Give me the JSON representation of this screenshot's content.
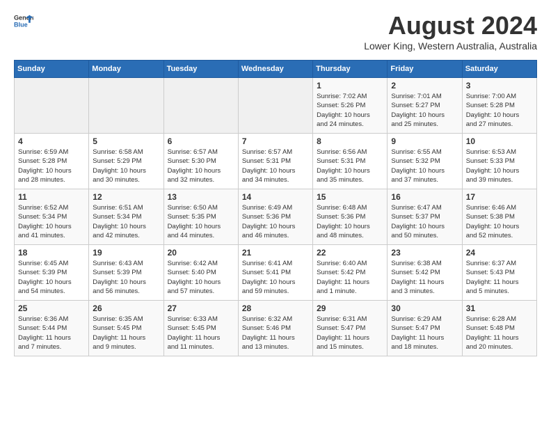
{
  "header": {
    "logo_general": "General",
    "logo_blue": "Blue",
    "title": "August 2024",
    "subtitle": "Lower King, Western Australia, Australia"
  },
  "weekdays": [
    "Sunday",
    "Monday",
    "Tuesday",
    "Wednesday",
    "Thursday",
    "Friday",
    "Saturday"
  ],
  "weeks": [
    [
      {
        "day": "",
        "info": ""
      },
      {
        "day": "",
        "info": ""
      },
      {
        "day": "",
        "info": ""
      },
      {
        "day": "",
        "info": ""
      },
      {
        "day": "1",
        "info": "Sunrise: 7:02 AM\nSunset: 5:26 PM\nDaylight: 10 hours\nand 24 minutes."
      },
      {
        "day": "2",
        "info": "Sunrise: 7:01 AM\nSunset: 5:27 PM\nDaylight: 10 hours\nand 25 minutes."
      },
      {
        "day": "3",
        "info": "Sunrise: 7:00 AM\nSunset: 5:28 PM\nDaylight: 10 hours\nand 27 minutes."
      }
    ],
    [
      {
        "day": "4",
        "info": "Sunrise: 6:59 AM\nSunset: 5:28 PM\nDaylight: 10 hours\nand 28 minutes."
      },
      {
        "day": "5",
        "info": "Sunrise: 6:58 AM\nSunset: 5:29 PM\nDaylight: 10 hours\nand 30 minutes."
      },
      {
        "day": "6",
        "info": "Sunrise: 6:57 AM\nSunset: 5:30 PM\nDaylight: 10 hours\nand 32 minutes."
      },
      {
        "day": "7",
        "info": "Sunrise: 6:57 AM\nSunset: 5:31 PM\nDaylight: 10 hours\nand 34 minutes."
      },
      {
        "day": "8",
        "info": "Sunrise: 6:56 AM\nSunset: 5:31 PM\nDaylight: 10 hours\nand 35 minutes."
      },
      {
        "day": "9",
        "info": "Sunrise: 6:55 AM\nSunset: 5:32 PM\nDaylight: 10 hours\nand 37 minutes."
      },
      {
        "day": "10",
        "info": "Sunrise: 6:53 AM\nSunset: 5:33 PM\nDaylight: 10 hours\nand 39 minutes."
      }
    ],
    [
      {
        "day": "11",
        "info": "Sunrise: 6:52 AM\nSunset: 5:34 PM\nDaylight: 10 hours\nand 41 minutes."
      },
      {
        "day": "12",
        "info": "Sunrise: 6:51 AM\nSunset: 5:34 PM\nDaylight: 10 hours\nand 42 minutes."
      },
      {
        "day": "13",
        "info": "Sunrise: 6:50 AM\nSunset: 5:35 PM\nDaylight: 10 hours\nand 44 minutes."
      },
      {
        "day": "14",
        "info": "Sunrise: 6:49 AM\nSunset: 5:36 PM\nDaylight: 10 hours\nand 46 minutes."
      },
      {
        "day": "15",
        "info": "Sunrise: 6:48 AM\nSunset: 5:36 PM\nDaylight: 10 hours\nand 48 minutes."
      },
      {
        "day": "16",
        "info": "Sunrise: 6:47 AM\nSunset: 5:37 PM\nDaylight: 10 hours\nand 50 minutes."
      },
      {
        "day": "17",
        "info": "Sunrise: 6:46 AM\nSunset: 5:38 PM\nDaylight: 10 hours\nand 52 minutes."
      }
    ],
    [
      {
        "day": "18",
        "info": "Sunrise: 6:45 AM\nSunset: 5:39 PM\nDaylight: 10 hours\nand 54 minutes."
      },
      {
        "day": "19",
        "info": "Sunrise: 6:43 AM\nSunset: 5:39 PM\nDaylight: 10 hours\nand 56 minutes."
      },
      {
        "day": "20",
        "info": "Sunrise: 6:42 AM\nSunset: 5:40 PM\nDaylight: 10 hours\nand 57 minutes."
      },
      {
        "day": "21",
        "info": "Sunrise: 6:41 AM\nSunset: 5:41 PM\nDaylight: 10 hours\nand 59 minutes."
      },
      {
        "day": "22",
        "info": "Sunrise: 6:40 AM\nSunset: 5:42 PM\nDaylight: 11 hours\nand 1 minute."
      },
      {
        "day": "23",
        "info": "Sunrise: 6:38 AM\nSunset: 5:42 PM\nDaylight: 11 hours\nand 3 minutes."
      },
      {
        "day": "24",
        "info": "Sunrise: 6:37 AM\nSunset: 5:43 PM\nDaylight: 11 hours\nand 5 minutes."
      }
    ],
    [
      {
        "day": "25",
        "info": "Sunrise: 6:36 AM\nSunset: 5:44 PM\nDaylight: 11 hours\nand 7 minutes."
      },
      {
        "day": "26",
        "info": "Sunrise: 6:35 AM\nSunset: 5:45 PM\nDaylight: 11 hours\nand 9 minutes."
      },
      {
        "day": "27",
        "info": "Sunrise: 6:33 AM\nSunset: 5:45 PM\nDaylight: 11 hours\nand 11 minutes."
      },
      {
        "day": "28",
        "info": "Sunrise: 6:32 AM\nSunset: 5:46 PM\nDaylight: 11 hours\nand 13 minutes."
      },
      {
        "day": "29",
        "info": "Sunrise: 6:31 AM\nSunset: 5:47 PM\nDaylight: 11 hours\nand 15 minutes."
      },
      {
        "day": "30",
        "info": "Sunrise: 6:29 AM\nSunset: 5:47 PM\nDaylight: 11 hours\nand 18 minutes."
      },
      {
        "day": "31",
        "info": "Sunrise: 6:28 AM\nSunset: 5:48 PM\nDaylight: 11 hours\nand 20 minutes."
      }
    ]
  ]
}
